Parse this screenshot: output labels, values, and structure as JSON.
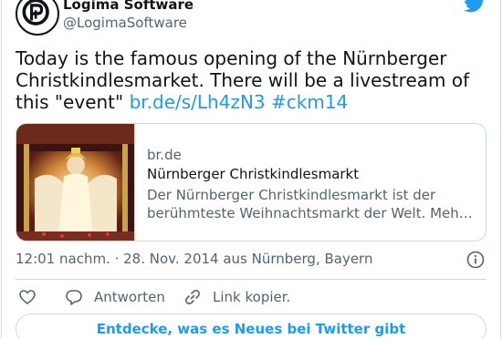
{
  "author": {
    "name": "Logima Software",
    "handle": "@LogimaSoftware"
  },
  "tweet": {
    "text": "Today is the famous opening of the Nürnberger Christkindlesmarket. There will be a livestream of this \"event\" ",
    "link_text": "br.de/s/Lh4zN3",
    "hashtag": "#ckm14"
  },
  "link_card": {
    "domain": "br.de",
    "title": "Nürnberger Christkindlesmarkt",
    "description": "Der Nürnberger Christkindlesmarkt ist der berühmteste Weihnachtsmarkt der Welt. Meh…"
  },
  "meta": {
    "timestamp": "12:01 nachm. · 28. Nov. 2014 aus Nürnberg, Bayern"
  },
  "actions": {
    "reply_label": "Antworten",
    "copy_label": "Link kopier."
  },
  "discover": {
    "label": "Entdecke, was es Neues bei Twitter gibt"
  },
  "colors": {
    "accent": "#1d9bf0",
    "text": "#0f1419",
    "muted": "#536471",
    "border": "#cfd9de"
  },
  "icons": [
    "twitter-bird-icon",
    "heart-icon",
    "reply-bubble-icon",
    "link-icon",
    "info-icon"
  ]
}
